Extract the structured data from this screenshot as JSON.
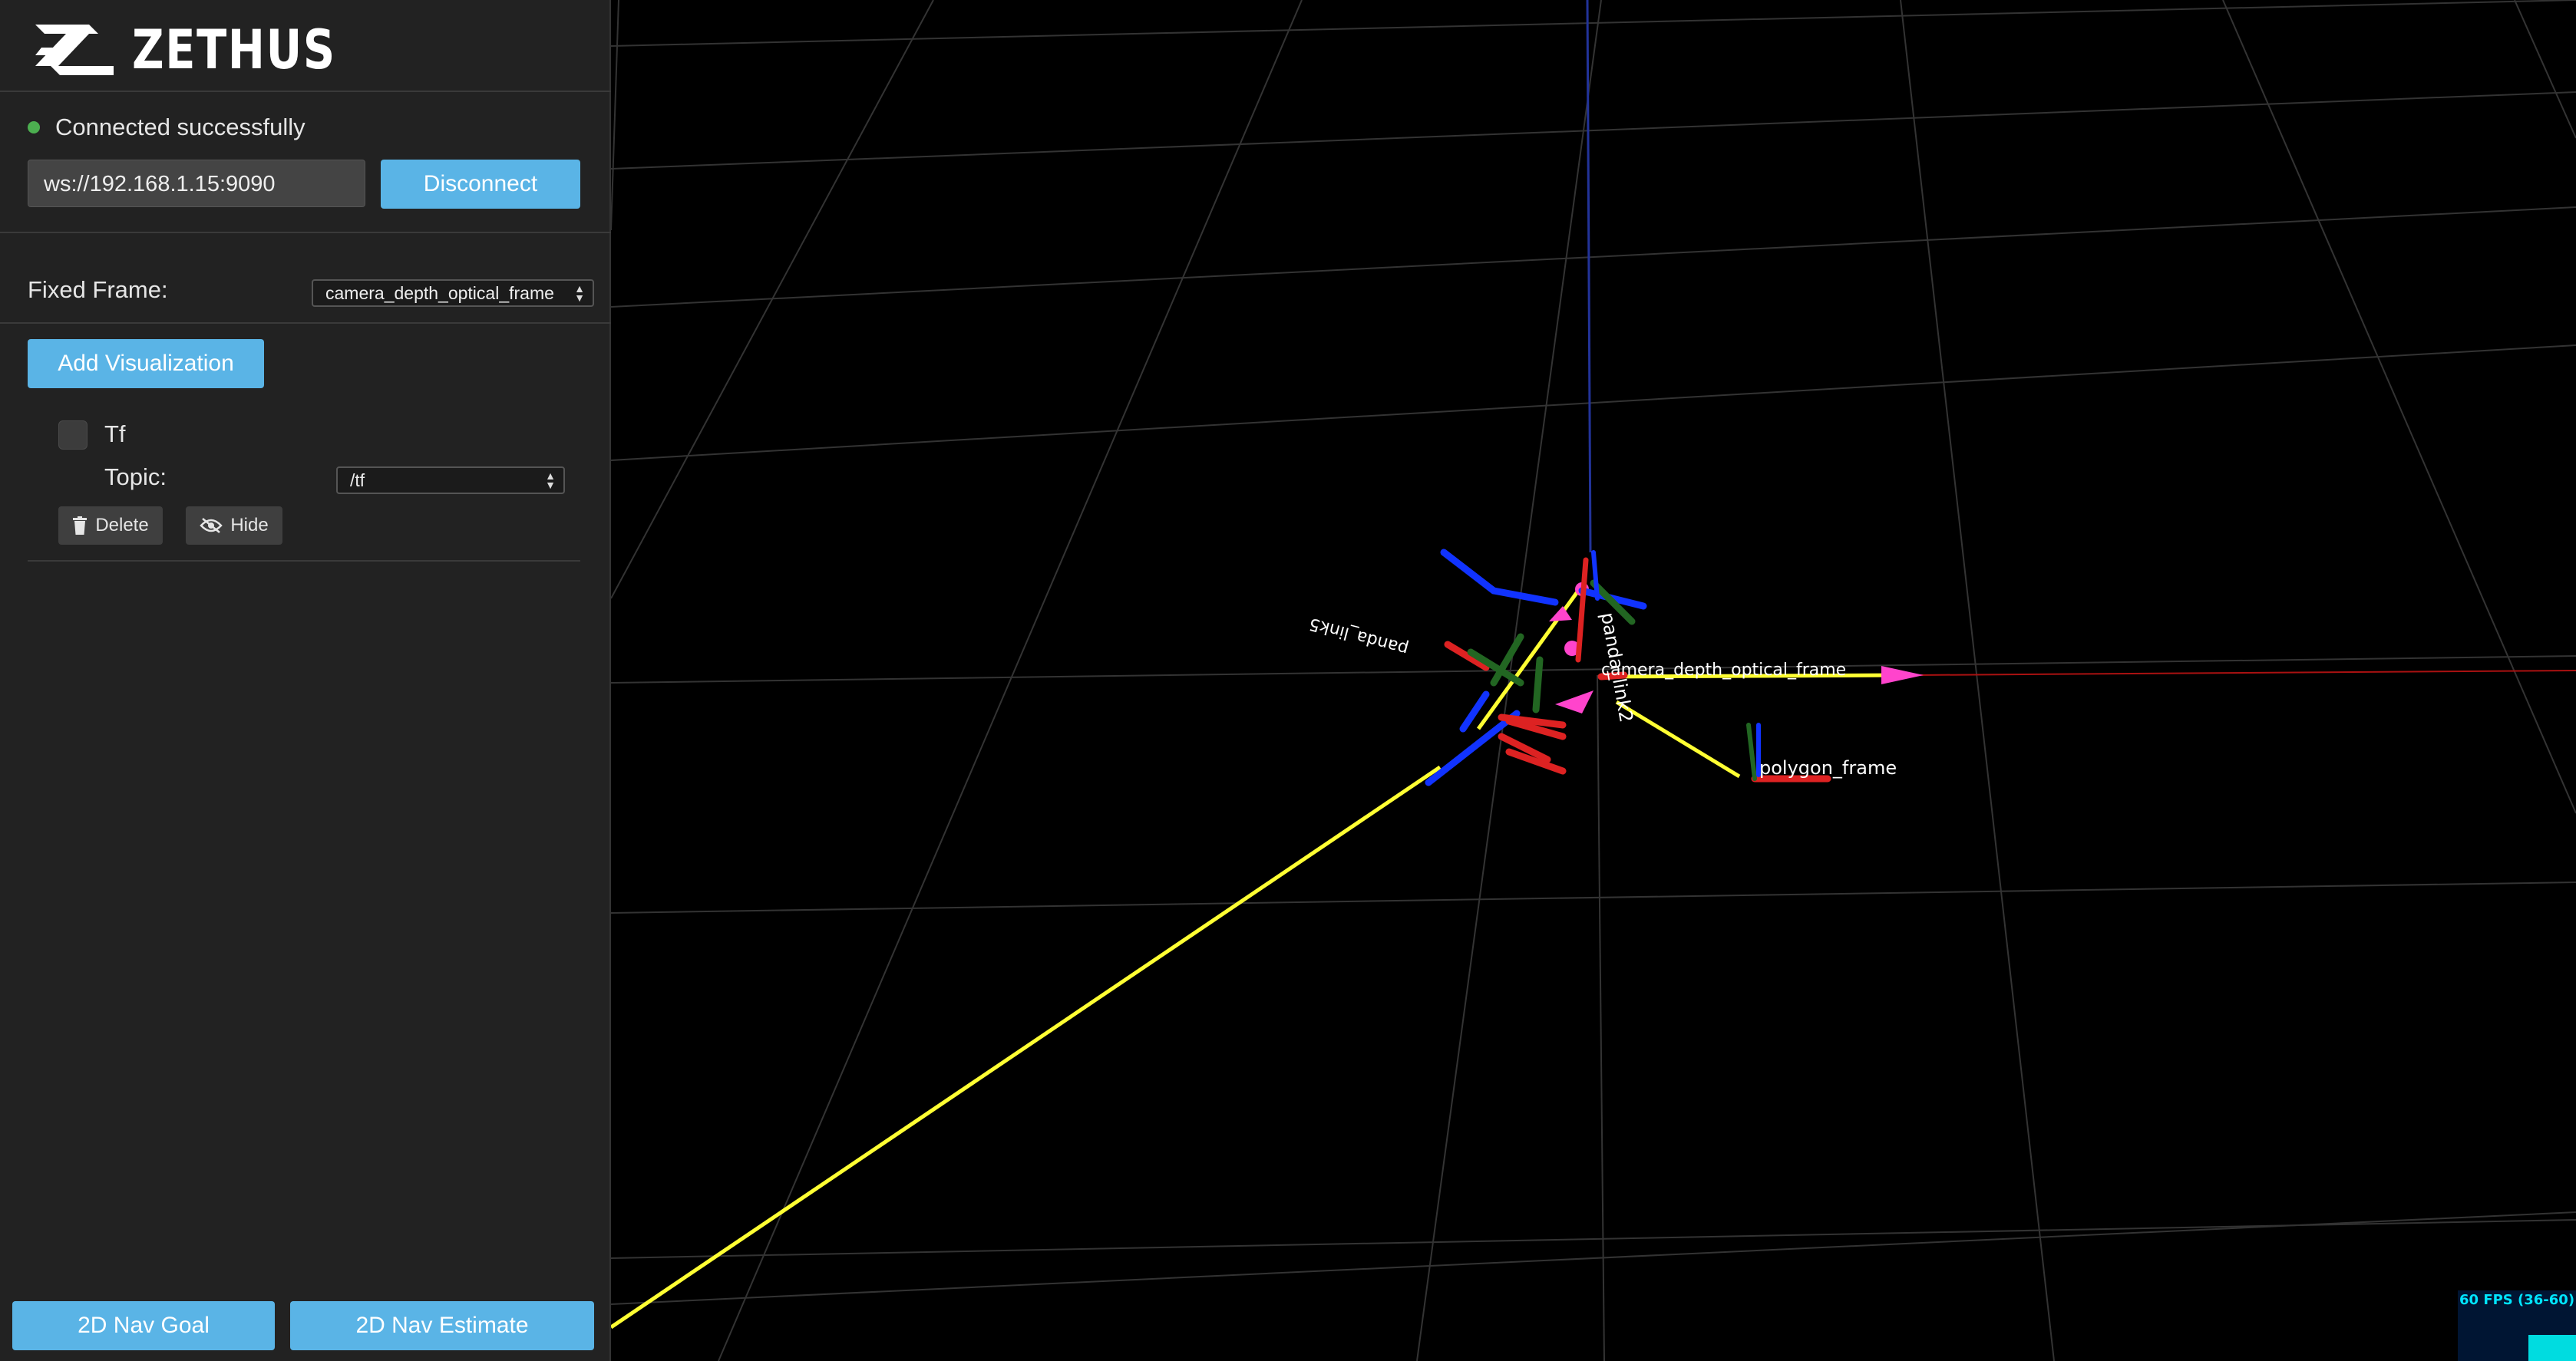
{
  "app": {
    "logo_text": "ZETHUS"
  },
  "connection": {
    "status_text": "Connected successfully",
    "status_color": "#4caf50",
    "url_value": "ws://192.168.1.15:9090",
    "disconnect_label": "Disconnect"
  },
  "fixed_frame": {
    "label": "Fixed Frame:",
    "selected": "camera_depth_optical_frame"
  },
  "add_visualization_label": "Add Visualization",
  "visualization": {
    "name": "Tf",
    "checked": false,
    "topic_label": "Topic:",
    "topic_selected": "/tf",
    "delete_label": "Delete",
    "hide_label": "Hide"
  },
  "nav": {
    "goal_label": "2D Nav Goal",
    "estimate_label": "2D Nav Estimate"
  },
  "scene": {
    "frame_labels": [
      "camera_depth_optical_frame",
      "polygon_frame",
      "panda_link2",
      "panda_link5"
    ]
  },
  "stats": {
    "fps_text": "60 FPS (36-60)"
  },
  "colors": {
    "accent": "#5ab4e6",
    "sidebar_bg": "#222222",
    "viewport_bg": "#000000",
    "tf_link": "#ffff33",
    "axis_x": "#ff2222",
    "axis_y": "#228822",
    "axis_z": "#1133ff",
    "arrow": "#ff44cc"
  }
}
